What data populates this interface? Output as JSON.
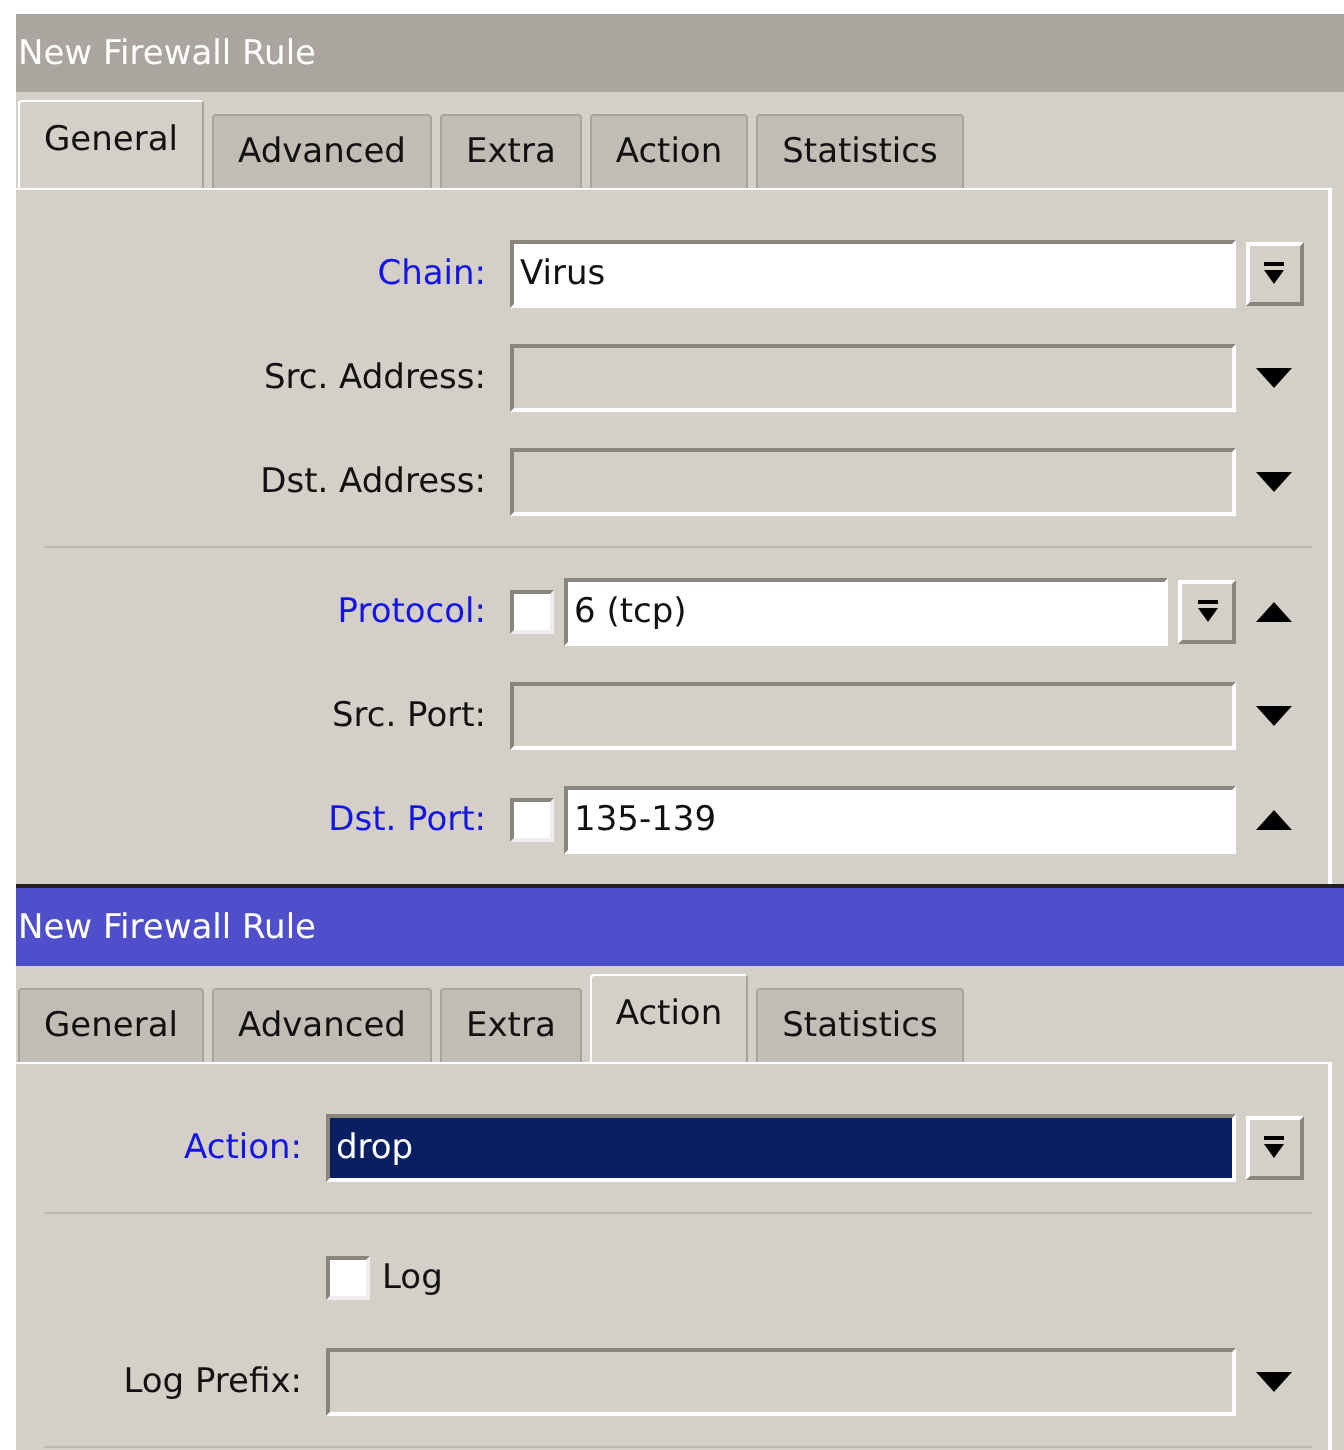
{
  "windows": [
    {
      "title": "New Firewall Rule",
      "active": false,
      "tabs": [
        {
          "label": "General",
          "selected": true
        },
        {
          "label": "Advanced",
          "selected": false
        },
        {
          "label": "Extra",
          "selected": false
        },
        {
          "label": "Action",
          "selected": false
        },
        {
          "label": "Statistics",
          "selected": false
        }
      ],
      "groups": [
        [
          {
            "kind": "field",
            "label": "Chain:",
            "emphasized": true,
            "value": "Virus",
            "enabled": true,
            "combo": true
          },
          {
            "kind": "field",
            "label": "Src. Address:",
            "emphasized": false,
            "enabled": false,
            "expanded": false
          },
          {
            "kind": "field",
            "label": "Dst. Address:",
            "emphasized": false,
            "enabled": false,
            "expanded": false
          }
        ],
        [
          {
            "kind": "field",
            "label": "Protocol:",
            "emphasized": true,
            "negate": false,
            "value": "6 (tcp)",
            "enabled": true,
            "combo": true,
            "expanded": true
          },
          {
            "kind": "field",
            "label": "Src. Port:",
            "emphasized": false,
            "enabled": false,
            "expanded": false
          },
          {
            "kind": "field",
            "label": "Dst. Port:",
            "emphasized": true,
            "negate": false,
            "value": "135-139",
            "enabled": true,
            "expanded": true
          }
        ]
      ]
    },
    {
      "title": "New Firewall Rule",
      "active": true,
      "tabs": [
        {
          "label": "General",
          "selected": false
        },
        {
          "label": "Advanced",
          "selected": false
        },
        {
          "label": "Extra",
          "selected": false
        },
        {
          "label": "Action",
          "selected": true
        },
        {
          "label": "Statistics",
          "selected": false
        }
      ],
      "groups": [
        [
          {
            "kind": "field",
            "label": "Action:",
            "emphasized": true,
            "value": "drop",
            "highlighted": true,
            "combo": true
          }
        ],
        [
          {
            "kind": "checkbox",
            "label": "Log",
            "checked": false
          },
          {
            "kind": "field",
            "label": "Log Prefix:",
            "emphasized": false,
            "enabled": false,
            "expanded": false
          }
        ]
      ]
    }
  ]
}
